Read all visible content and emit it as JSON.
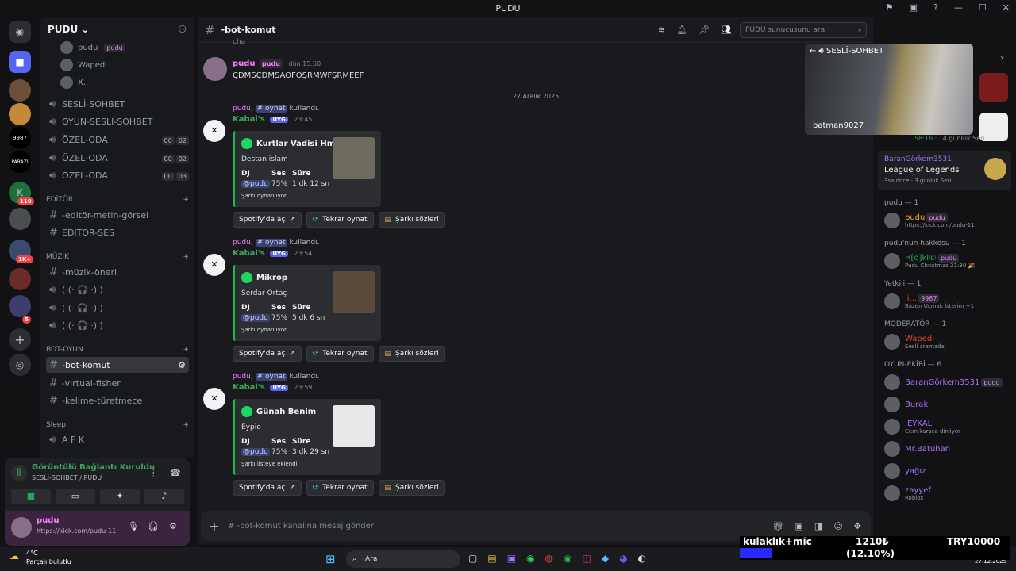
{
  "window": {
    "title": "PUDU"
  },
  "server": {
    "name": "PUDU"
  },
  "rail": {
    "badges": [
      "110",
      "1K+",
      "5"
    ],
    "rail_label_9987": "9987",
    "rail_label_paraz": "PARAZİ"
  },
  "voice_users": [
    {
      "name": "pudu",
      "tag": "pudu"
    },
    {
      "name": "Wapedi"
    },
    {
      "name": "X.."
    }
  ],
  "channels": {
    "voice_top": [
      {
        "label": "SESLİ-SOHBET"
      },
      {
        "label": "OYUN-SESLİ-SOHBET"
      },
      {
        "label": "ÖZEL-ODA",
        "a": "00",
        "b": "02"
      },
      {
        "label": "ÖZEL-ODA",
        "a": "00",
        "b": "02"
      },
      {
        "label": "ÖZEL-ODA",
        "a": "00",
        "b": "03"
      }
    ],
    "cat_editor": "EDİTÖR",
    "editor": [
      "-editör-metin-görsel",
      "EDİTÖR-SES"
    ],
    "cat_muzik": "MÜZİK",
    "muzik": [
      "-müzik-öneri",
      "( (· 🎧 ·) )",
      "( (· 🎧 ·) )",
      "( (· 🎧 ·) )"
    ],
    "cat_bot": "BOT-OYUN",
    "bot": [
      "-bot-komut",
      "-virtual-fisher",
      "-kelime-türetmece"
    ],
    "cat_sleep": "Sleep",
    "sleep": [
      "A F K"
    ]
  },
  "voice_panel": {
    "status": "Görüntülü Bağlantı Kuruldu",
    "channel": "SESLİ-SOHBET / PUDU",
    "user_name": "pudu",
    "user_status": "https://kick.com/pudu-11"
  },
  "header": {
    "channel": "-bot-komut",
    "search_placeholder": "PUDU sunucusunu ara"
  },
  "messages": {
    "partial_top": "cha",
    "first": {
      "author": "pudu",
      "tag": "pudu",
      "time": "dün 15:50",
      "text": "ÇDMSÇDMSAÖFÖŞRMWFŞRMEEF"
    },
    "date_divider": "27 Aralık 2025",
    "used_word": "kullandı.",
    "used_user": "pudu",
    "used_cmd": "oynat",
    "bot_name": "Kabal's",
    "bot_tag": "UYG",
    "field_dj": "DJ",
    "field_ses": "Ses",
    "field_sure": "Süre",
    "btn_spotify": "Spotify'da aç",
    "btn_replay": "Tekrar oynat",
    "btn_lyrics": "Şarkı sözleri",
    "songs": [
      {
        "time": "23:45",
        "title": "Kurtlar Vadisi Hmm",
        "artist": "Destan islam",
        "dj": "@pudu",
        "vol": "75%",
        "dur": "1 dk 12 sn",
        "status": "Şarkı oynatılıyor."
      },
      {
        "time": "23:54",
        "title": "Mikrop",
        "artist": "Serdar Ortaç",
        "dj": "@pudu",
        "vol": "75%",
        "dur": "5 dk 6 sn",
        "status": "Şarkı oynatılıyor."
      },
      {
        "time": "23:59",
        "title": "Günah Benim",
        "artist": "Eypio",
        "dj": "@pudu",
        "vol": "75%",
        "dur": "3 dk 29 sn",
        "status": "Şarkı listeye eklendi."
      }
    ],
    "composer_placeholder": "-bot-komut kanalına mesaj gönder"
  },
  "video_popup": {
    "channel": "SESLİ-SOHBET",
    "user": "batman9027"
  },
  "members": {
    "top_activity": {
      "a": "58:16",
      "b": "14 günlük Seri"
    },
    "lol_user": "BaranGörkem3531",
    "lol_game": "League of Legends",
    "lol_sub": "3sa önce",
    "lol_sub2": "3 günlük Seri",
    "groups": [
      {
        "title": "pudu — 1",
        "members": [
          {
            "name": "pudu",
            "tag": "pudu",
            "sub": "https://kick.com/pudu-11",
            "color": "#f0b232"
          }
        ]
      },
      {
        "title": "pudu'nun hakkosu — 1",
        "members": [
          {
            "name": "H[o]kl©",
            "tag": "pudu",
            "sub": "Pudu Christmas 21:30 🎉",
            "color": "#23a559"
          }
        ]
      },
      {
        "title": "Yetkili — 1",
        "members": [
          {
            "name": "li...",
            "tag": "9987",
            "sub": "Bazen Uçmak İsterim +1",
            "color": "#e0443d"
          }
        ]
      },
      {
        "title": "MODERATÖR — 1",
        "members": [
          {
            "name": "Wapedi",
            "sub": "Sesli aramada",
            "color": "#e0443d"
          }
        ]
      },
      {
        "title": "OYUN-EKİBİ — 6",
        "members": [
          {
            "name": "BaranGörkem3531",
            "tag": "pudu",
            "color": "#a970ff"
          },
          {
            "name": "Burak",
            "color": "#a970ff"
          },
          {
            "name": "JEYKAL",
            "sub": "Cem karaca dinliyor",
            "color": "#a970ff"
          },
          {
            "name": "Mr.Batuhan",
            "color": "#a970ff"
          },
          {
            "name": "yağız",
            "color": "#a970ff"
          },
          {
            "name": "zayyef",
            "sub": "Roblox",
            "color": "#a970ff"
          }
        ]
      }
    ]
  },
  "taskbar": {
    "weather_temp": "4°C",
    "weather_desc": "Parçalı bulutlu",
    "search": "Ara",
    "date": "27.12.2025"
  },
  "ticker": {
    "left": "kulaklık+mic",
    "mid1": "1210₺",
    "mid2": "(12.10%)",
    "right": "TRY10000"
  }
}
